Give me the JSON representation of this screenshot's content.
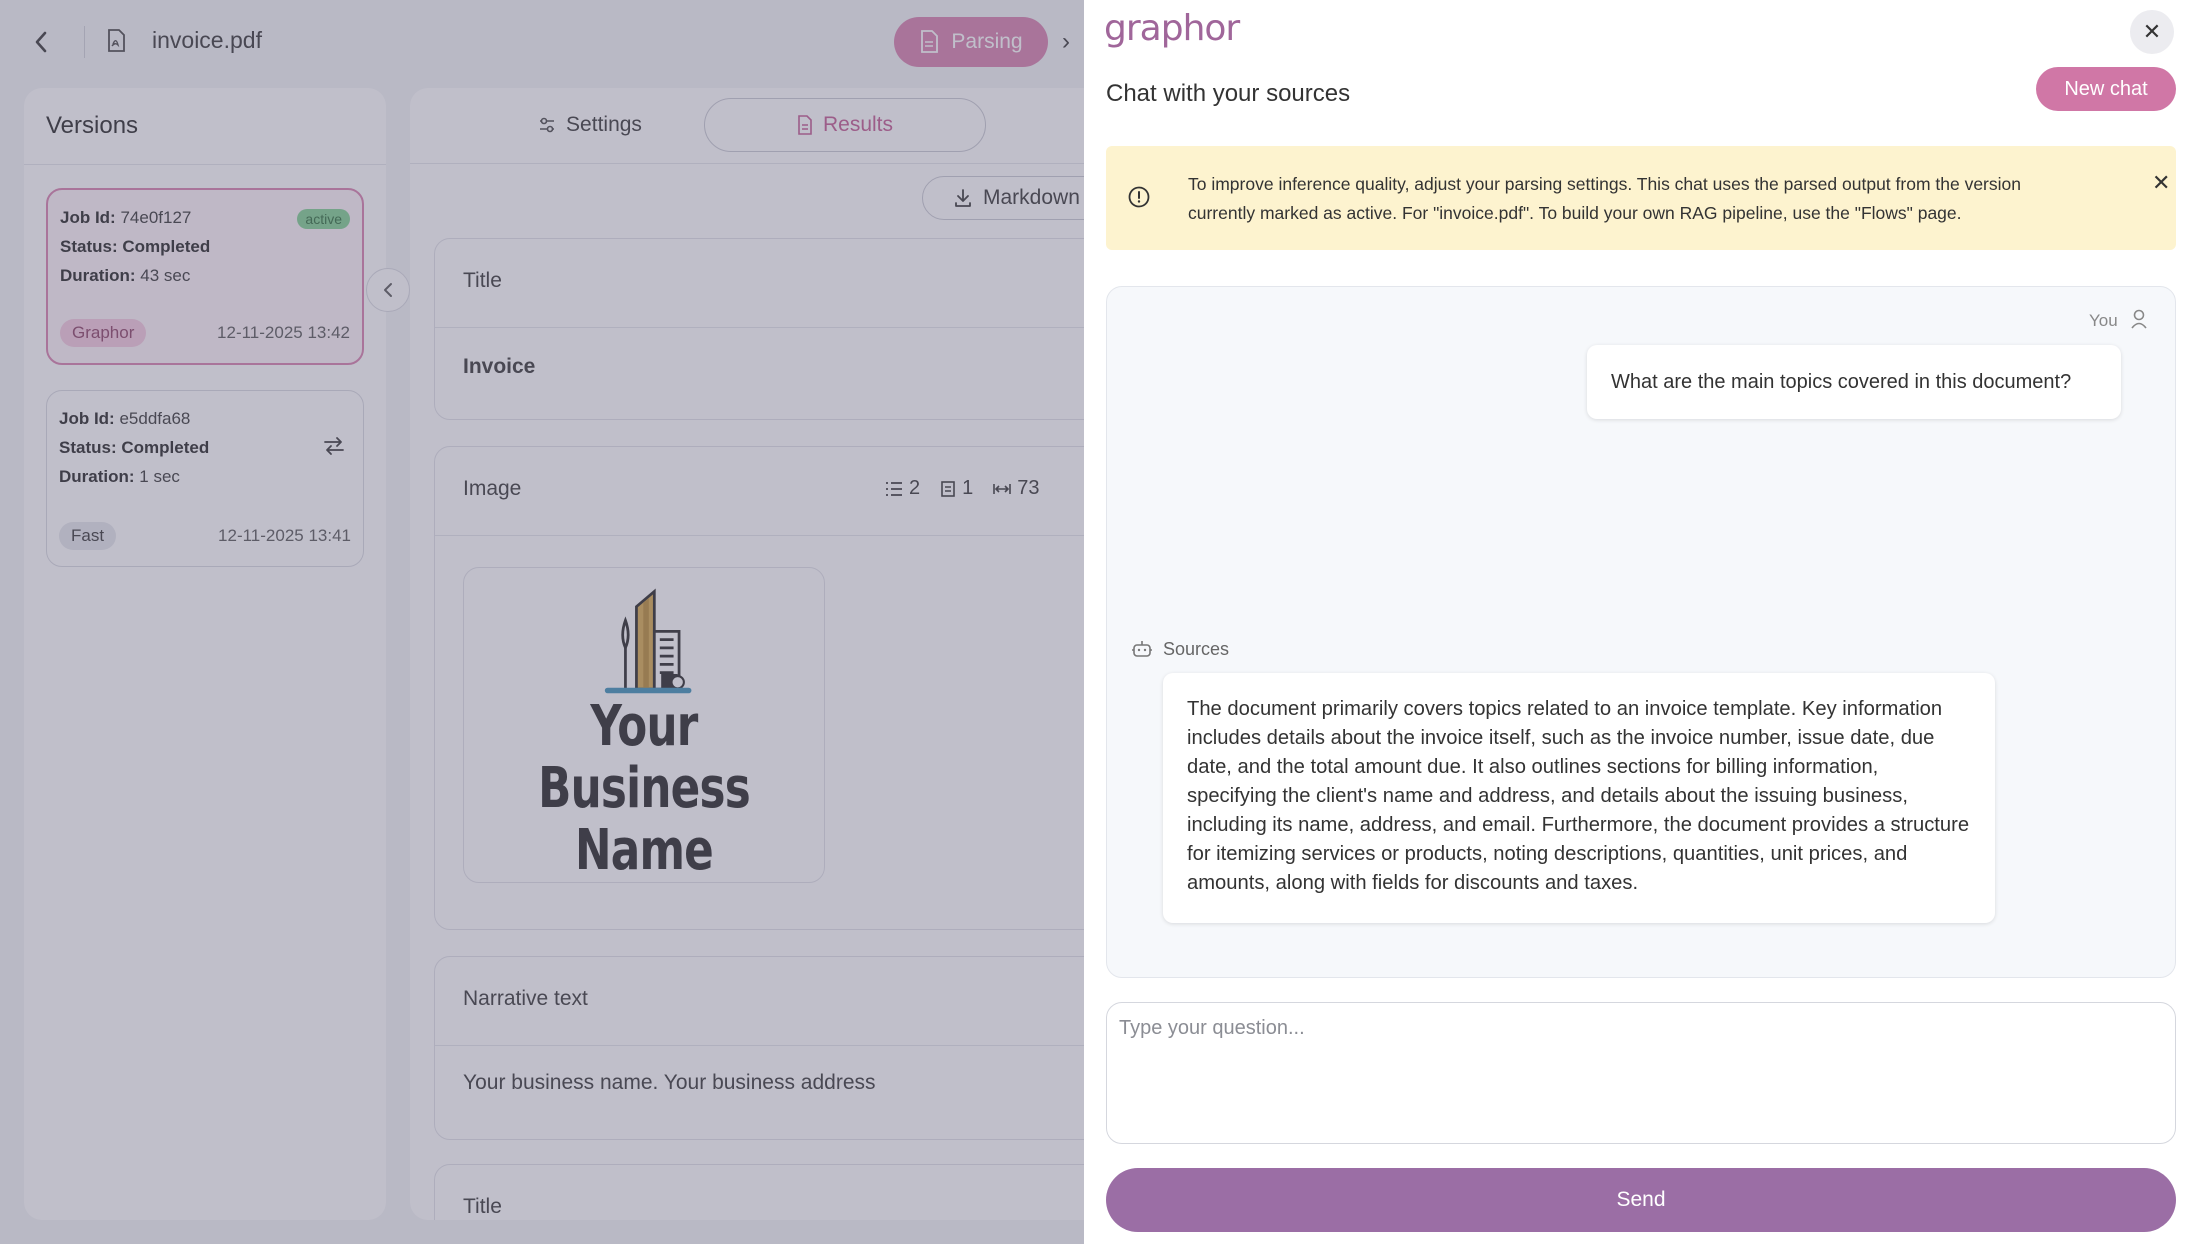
{
  "topbar": {
    "file_name": "invoice.pdf",
    "mode_label": "Parsing"
  },
  "versions": {
    "title": "Versions",
    "items": [
      {
        "job_label": "Job Id:",
        "job_id": "74e0f127",
        "status_label": "Status:",
        "status": "Completed",
        "duration_label": "Duration:",
        "duration": "43 sec",
        "badge": "active",
        "tag": "Graphor",
        "date": "12-11-2025 13:42"
      },
      {
        "job_label": "Job Id:",
        "job_id": "e5ddfa68",
        "status_label": "Status:",
        "status": "Completed",
        "duration_label": "Duration:",
        "duration": "1 sec",
        "tag": "Fast",
        "date": "12-11-2025 13:41"
      }
    ]
  },
  "results": {
    "tabs": {
      "settings": "Settings",
      "results": "Results"
    },
    "markdown_label": "Markdown",
    "blocks": [
      {
        "head": "Title",
        "body": "Invoice"
      },
      {
        "head": "Image",
        "meta": [
          "2",
          "1",
          "73"
        ],
        "image_text_1": "Your Business",
        "image_text_2": "Name"
      },
      {
        "head": "Narrative text",
        "body": "Your business name. Your business address"
      },
      {
        "head": "Title"
      }
    ]
  },
  "chat": {
    "logo": "graphor",
    "title": "Chat with your sources",
    "new_chat_label": "New chat",
    "notice": "To improve inference quality, adjust your parsing settings. This chat uses the parsed output from the version currently marked as active. For \"invoice.pdf\". To build your own RAG pipeline, use the \"Flows\" page.",
    "user_label": "You",
    "user_message": "What are the main topics covered in this document?",
    "sources_label": "Sources",
    "assistant_message": "The document primarily covers topics related to an invoice template. Key information includes details about the invoice itself, such as the invoice number, issue date, due date, and the total amount due. It also outlines sections for billing information, specifying the client's name and address, and details about the issuing business, including its name, address, and email. Furthermore, the document provides a structure for itemizing services or products, noting descriptions, quantities, unit prices, and amounts, along with fields for discounts and taxes.",
    "input_placeholder": "Type your question...",
    "send_label": "Send"
  },
  "colors": {
    "accent_pink": "#d077a6",
    "send_purple": "#9b6ea5",
    "notice_yellow": "#fdf3cf",
    "active_green": "#7fcf90"
  }
}
